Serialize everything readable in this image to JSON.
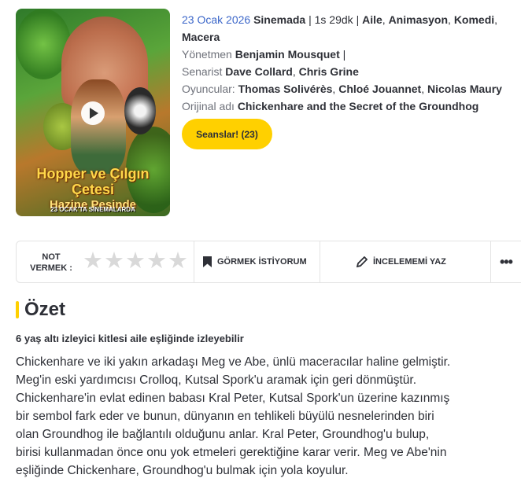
{
  "poster": {
    "title_line1": "Hopper ve Çılgın Çetesi",
    "title_line2": "Hazine Peşinde",
    "date_text": "23 OCAK'TA SİNEMALARDA"
  },
  "movie": {
    "release": "23 Ocak 2026",
    "release_suffix": "Sinemada",
    "duration": "1s 29dk",
    "genres": [
      "Aile",
      "Animasyon",
      "Komedi"
    ],
    "genre_line2": "Macera",
    "director_label": "Yönetmen",
    "director": "Benjamin Mousquet",
    "writer_label": "Senarist",
    "writers": [
      "Dave Collard",
      "Chris Grine"
    ],
    "cast_label": "Oyuncular:",
    "cast": [
      "Thomas Solivérès",
      "Chloé Jouannet",
      "Nicolas Maury"
    ],
    "original_label": "Orijinal adı",
    "original_title": "Chickenhare and the Secret of the Groundhog"
  },
  "seanslar_button": "Seanslar! (23)",
  "actions": {
    "rate_line1": "NOT",
    "rate_line2": "VERMEK :",
    "stars_count": 5,
    "watchlist": "GÖRMEK İSTİYORUM",
    "review": "İNCELEMEMİ YAZ",
    "more": "•••"
  },
  "summary": {
    "heading": "Özet",
    "age_note": "6 yaş altı izleyici kitlesi aile eşliğinde izleyebilir",
    "lines": [
      "Chickenhare ve iki yakın arkadaşı Meg ve Abe, ünlü maceracılar haline gelmiştir.",
      "Meg'in eski yardımcısı Crolloq, Kutsal Spork'u aramak için geri dönmüştür.",
      "Chickenhare'in evlat edinen babası Kral Peter, Kutsal Spork'un üzerine kazınmış",
      "bir sembol fark eder ve bunun, dünyanın en tehlikeli büyülü nesnelerinden biri",
      "olan Groundhog ile bağlantılı olduğunu anlar. Kral Peter, Groundhog'u bulup,",
      "birisi kullanmadan önce onu yok etmeleri gerektiğine karar verir. Meg ve Abe'nin",
      "eşliğinde Chickenhare, Groundhog'u bulmak için yola koyulur."
    ]
  }
}
